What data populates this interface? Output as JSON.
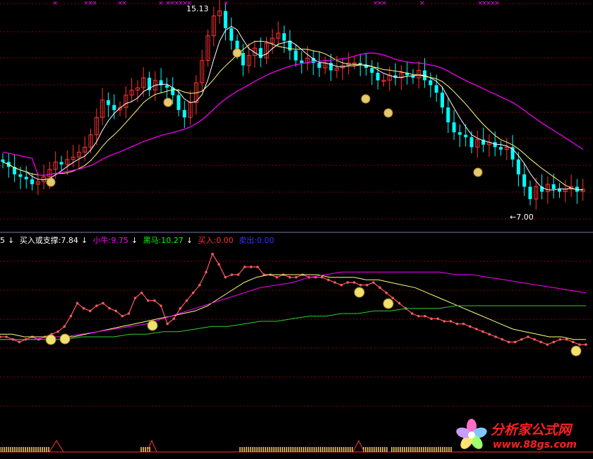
{
  "colors": {
    "background": "#000000",
    "grid": "#8b0000",
    "separator": "#7a7ab0",
    "candle_up": "#ff3232",
    "candle_down": "#00ffff",
    "ma_short": "#ffffff",
    "ma_mid": "#ffff80",
    "ma_long": "#ff00ff",
    "lower_main": "#ff5a5a",
    "lower_yellow": "#ffff80",
    "lower_magenta": "#ff00ff",
    "lower_green": "#32cd32",
    "marker_x": "#ff00ff",
    "legend_white": "#ffffff",
    "legend_magenta": "#ff00ff",
    "legend_green": "#00ff00",
    "legend_red": "#ff3232",
    "legend_blue": "#3232ff",
    "bottom_yellow": "#ffd070",
    "logo_text": "#ff2020"
  },
  "legend": {
    "prefix": "5",
    "buy_support": "买入或支撑:7.84",
    "small_bull": "小牛:9.75",
    "dark_horse": "黑马:10.27",
    "buy": "买入:0.00",
    "sell": "卖出:0.00",
    "arrow": "↓"
  },
  "annotations": {
    "high": "15.13",
    "low": "←7.00"
  },
  "logo": {
    "name": "分析家公式网",
    "url": "www.88gs.com"
  },
  "chart_data": [
    {
      "type": "candlestick",
      "panel": "upper",
      "y_range": [
        6.6,
        15.3
      ],
      "annotations": [
        "15.13",
        "←7.00"
      ],
      "closes": [
        8.9,
        8.7,
        8.4,
        8.3,
        8.2,
        8.0,
        8.1,
        8.3,
        8.6,
        8.9,
        8.8,
        9.0,
        9.1,
        9.3,
        9.5,
        10.0,
        10.7,
        11.4,
        11.2,
        11.0,
        11.1,
        11.6,
        11.8,
        11.9,
        12.3,
        11.8,
        12.2,
        12.0,
        11.9,
        11.6,
        11.0,
        10.7,
        11.3,
        12.1,
        13.0,
        14.0,
        14.8,
        15.0,
        14.3,
        13.8,
        13.3,
        12.8,
        13.2,
        13.5,
        13.1,
        13.7,
        13.9,
        14.1,
        13.8,
        13.4,
        13.0,
        12.9,
        13.1,
        12.9,
        12.7,
        12.9,
        12.6,
        12.7,
        12.8,
        12.9,
        12.9,
        12.8,
        12.7,
        12.5,
        12.2,
        12.2,
        12.4,
        12.3,
        12.5,
        12.4,
        12.3,
        12.6,
        12.2,
        12.0,
        11.7,
        11.1,
        10.5,
        10.1,
        10.0,
        9.9,
        9.5,
        9.8,
        9.6,
        9.7,
        9.5,
        9.4,
        9.5,
        9.0,
        8.4,
        7.9,
        7.4,
        7.9,
        7.7,
        8.0,
        7.8,
        7.7,
        7.8,
        7.9,
        7.7,
        7.8
      ]
    },
    {
      "type": "line",
      "panel": "lower",
      "series": [
        {
          "name": "买入或支撑",
          "values": [
            7.9,
            7.9,
            7.8,
            7.7,
            7.8,
            7.9,
            7.8,
            7.9,
            8.0,
            8.1,
            8.3,
            8.7,
            9.2,
            9.0,
            8.9,
            9.1,
            9.2,
            9.0,
            8.9,
            8.7,
            8.8,
            9.4,
            9.6,
            9.3,
            9.3,
            9.1,
            8.4,
            8.6,
            9.0,
            9.3,
            9.6,
            9.9,
            10.4,
            11.1,
            10.7,
            10.2,
            10.3,
            10.3,
            10.6,
            10.6,
            10.6,
            10.3,
            10.3,
            10.2,
            10.3,
            10.2,
            10.2,
            10.3,
            10.2,
            10.2,
            10.2,
            10.1,
            10.0,
            9.9,
            10.0,
            10.0,
            9.9,
            9.9,
            10.0,
            9.8,
            9.6,
            9.4,
            9.2,
            9.0,
            8.8,
            8.7,
            8.7,
            8.6,
            8.6,
            8.5,
            8.5,
            8.4,
            8.4,
            8.3,
            8.2,
            8.1,
            8.0,
            7.9,
            7.8,
            7.7,
            7.7,
            7.8,
            7.9,
            7.8,
            7.7,
            7.6,
            7.7,
            7.8,
            7.8,
            7.7,
            7.6,
            7.6
          ]
        },
        {
          "name": "小牛",
          "values": [
            8.0,
            8.0,
            7.9,
            7.9,
            7.9,
            7.9,
            7.9,
            8.0,
            8.1,
            8.2,
            8.3,
            8.4,
            8.5,
            8.6,
            8.7,
            8.8,
            8.9,
            9.1,
            9.4,
            9.7,
            10.0,
            10.2,
            10.3,
            10.3,
            10.3,
            10.3,
            10.3,
            10.2,
            10.2,
            10.2,
            10.1,
            10.1,
            10.0,
            9.9,
            9.8,
            9.6,
            9.4,
            9.2,
            9.0,
            8.8,
            8.6,
            8.4,
            8.2,
            8.1,
            8.0,
            7.9,
            7.9,
            7.8,
            7.8
          ]
        },
        {
          "name": "黑马",
          "values": [
            7.8,
            7.8,
            7.8,
            7.9,
            7.9,
            8.0,
            8.1,
            8.2,
            8.3,
            8.4,
            8.6,
            8.8,
            9.0,
            9.2,
            9.4,
            9.6,
            9.8,
            9.9,
            10.0,
            10.2,
            10.3,
            10.4,
            10.4,
            10.4,
            10.4,
            10.4,
            10.4,
            10.4,
            10.3,
            10.3,
            10.2,
            10.1,
            10.0,
            9.9,
            9.8,
            9.7,
            9.6
          ]
        },
        {
          "values": [
            7.8,
            7.8,
            7.8,
            7.8,
            7.8,
            7.9,
            7.9,
            7.9,
            8.0,
            8.0,
            8.1,
            8.1,
            8.2,
            8.3,
            8.3,
            8.4,
            8.5,
            8.5,
            8.6,
            8.7,
            8.7,
            8.8,
            8.8,
            8.9,
            8.9,
            9.0,
            9.0,
            9.0,
            9.1,
            9.1,
            9.1,
            9.1,
            9.1,
            9.1,
            9.1,
            9.1,
            9.1
          ]
        }
      ]
    }
  ]
}
